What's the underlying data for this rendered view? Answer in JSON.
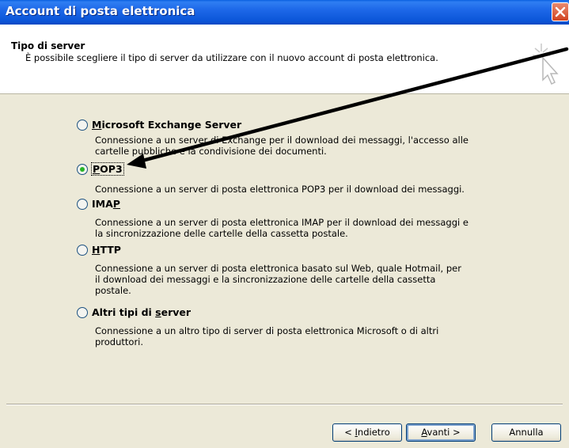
{
  "window": {
    "title": "Account di posta elettronica",
    "close_icon": "close-icon"
  },
  "header": {
    "title": "Tipo di server",
    "description": "È possibile scegliere il tipo di server da utilizzare con il nuovo account di posta elettronica."
  },
  "options": [
    {
      "label_pre": "",
      "label_ul": "M",
      "label_post": "icrosoft Exchange Server",
      "selected": false,
      "desc_lines": [
        "Connessione a un server di Exchange per il download dei messaggi, l'accesso alle",
        "cartelle pubbliche e la condivisione dei documenti."
      ]
    },
    {
      "label_pre": "",
      "label_ul": "P",
      "label_post": "OP3",
      "selected": true,
      "desc_lines": [
        "Connessione a un server di posta elettronica POP3 per il download dei messaggi."
      ]
    },
    {
      "label_pre": "IMA",
      "label_ul": "P",
      "label_post": "",
      "selected": false,
      "desc_lines": [
        "Connessione a un server di posta elettronica IMAP per il download dei messaggi e",
        "la sincronizzazione delle cartelle della cassetta postale."
      ]
    },
    {
      "label_pre": "",
      "label_ul": "H",
      "label_post": "TTP",
      "selected": false,
      "desc_lines": [
        "Connessione a un server di posta elettronica basato sul Web, quale Hotmail, per",
        "il download dei messaggi e la sincronizzazione delle cartelle della cassetta",
        "postale."
      ]
    },
    {
      "label_pre": "Altri tipi di ",
      "label_ul": "s",
      "label_post": "erver",
      "selected": false,
      "desc_lines": [
        "Connessione a un altro tipo di server di posta elettronica Microsoft o di altri",
        "produttori."
      ]
    }
  ],
  "buttons": {
    "back_pre": "< ",
    "back_ul": "I",
    "back_post": "ndietro",
    "next_pre": "",
    "next_ul": "A",
    "next_post": "vanti >",
    "cancel": "Annulla"
  },
  "colors": {
    "titlebar": "#0a5fe0",
    "dialog_bg": "#ece9d8",
    "radio_checked": "#28b428",
    "close_button": "#d1431f"
  }
}
